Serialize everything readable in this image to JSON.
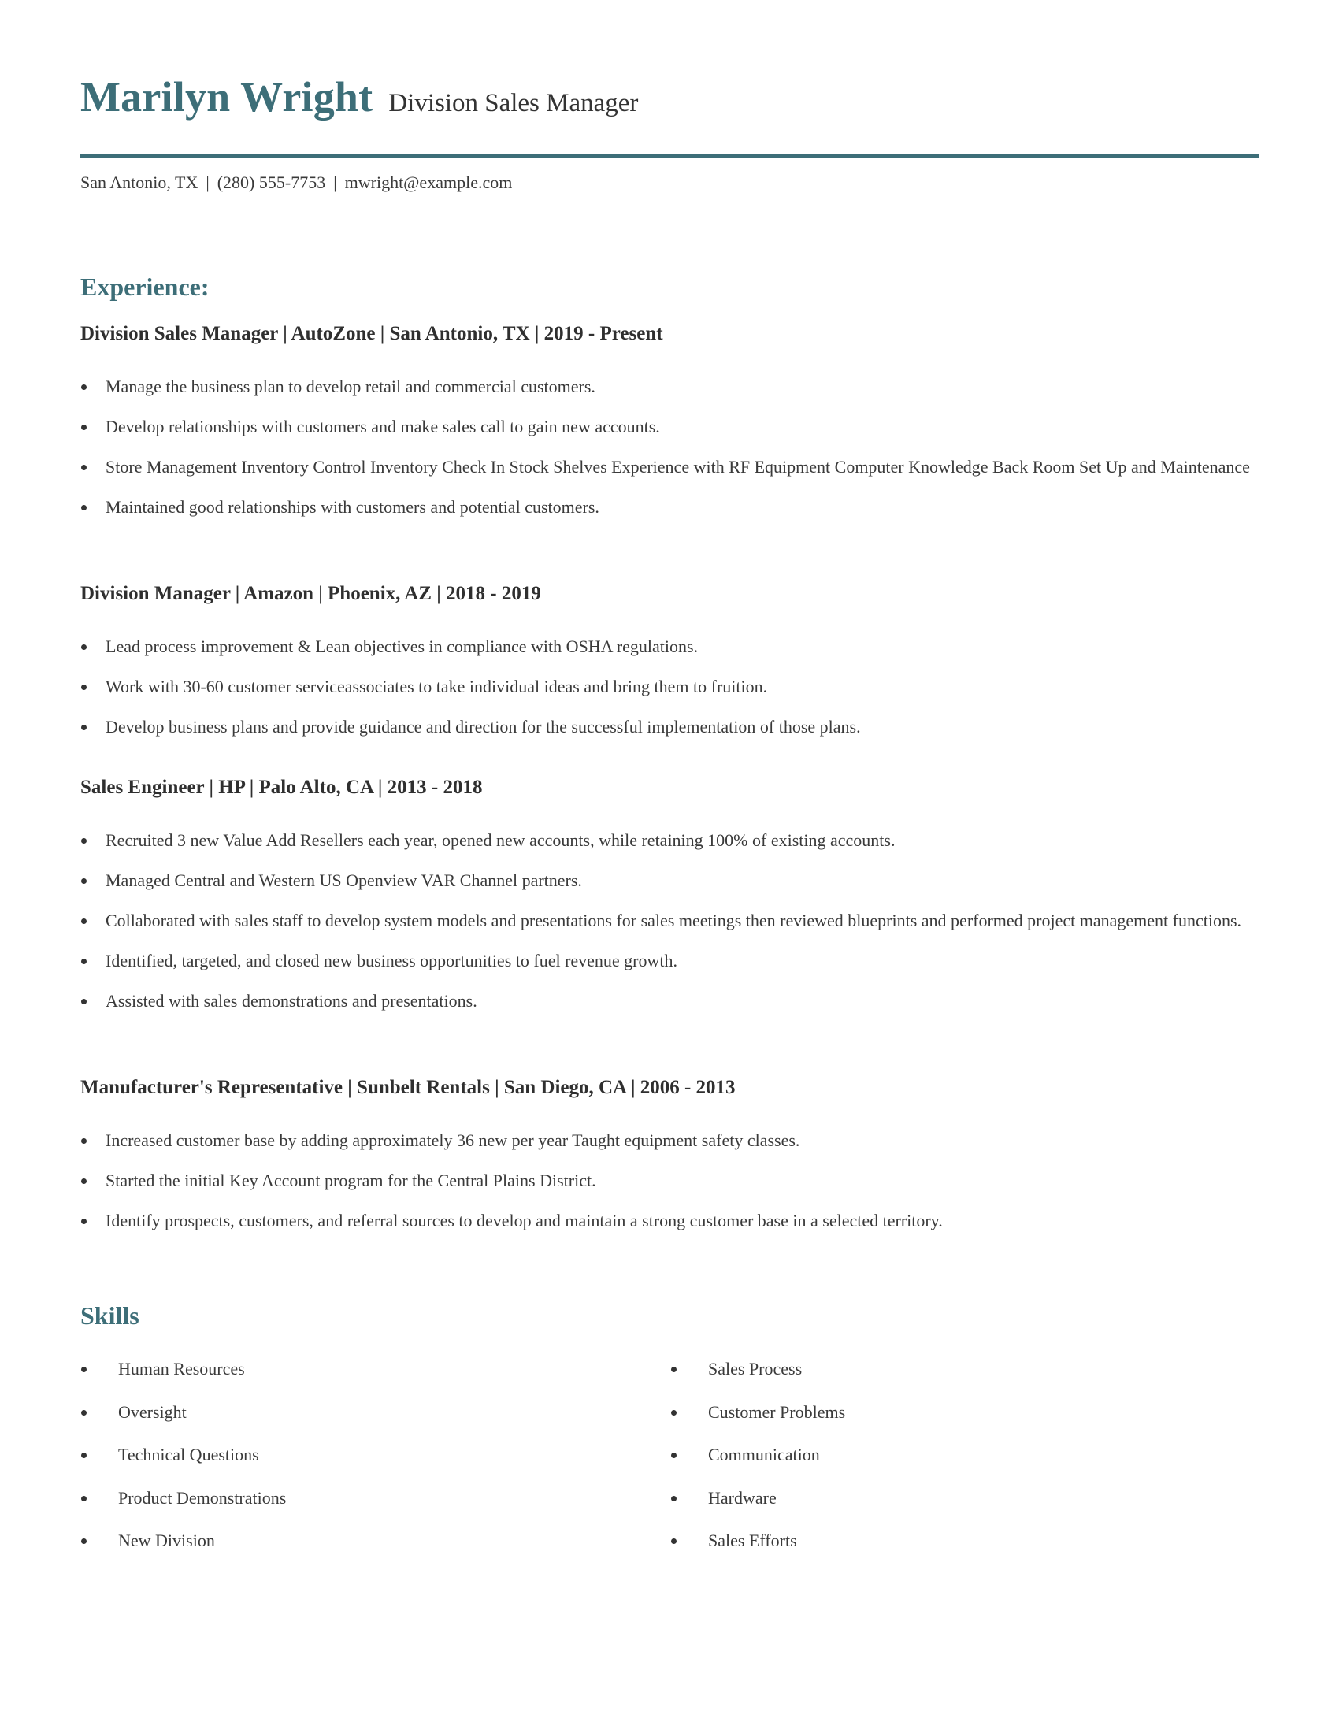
{
  "header": {
    "name": "Marilyn Wright",
    "title": "Division Sales Manager",
    "accent_color": "#3d6e78"
  },
  "contact": {
    "location": "San Antonio, TX",
    "phone": "(280) 555-7753",
    "email": "mwright@example.com",
    "separator": "|"
  },
  "experience": {
    "heading": "Experience:",
    "jobs": [
      {
        "heading": "Division Sales Manager | AutoZone | San Antonio, TX |  2019 - Present",
        "bullets": [
          "Manage the business plan to develop retail and commercial customers.",
          "Develop relationships with customers and make sales call to gain new accounts.",
          "Store Management Inventory Control Inventory Check In Stock Shelves Experience with RF Equipment Computer Knowledge Back Room Set Up and Maintenance",
          "Maintained good relationships with customers and potential customers."
        ]
      },
      {
        "heading": "Division Manager | Amazon | Phoenix, AZ |  2018 - 2019",
        "bullets": [
          "Lead process improvement & Lean objectives in compliance with OSHA regulations.",
          "Work with 30-60 customer serviceassociates to take individual ideas and bring them to fruition.",
          "Develop business plans and provide guidance and direction for the successful implementation of those plans."
        ]
      },
      {
        "heading": "Sales Engineer | HP | Palo Alto, CA |  2013 - 2018",
        "bullets": [
          "Recruited 3 new Value Add Resellers each year, opened new accounts, while retaining 100% of existing accounts.",
          "Managed Central and Western US Openview VAR Channel partners.",
          "Collaborated with sales staff to develop system models and presentations for sales meetings then reviewed blueprints and performed project management functions.",
          "Identified, targeted, and closed new business opportunities to fuel revenue growth.",
          "Assisted with sales demonstrations and presentations."
        ]
      },
      {
        "heading": "Manufacturer's Representative | Sunbelt Rentals | San Diego, CA |  2006 - 2013",
        "bullets": [
          "Increased customer base by adding approximately 36 new per year Taught equipment safety classes.",
          "Started the initial Key Account program for the Central Plains District.",
          "Identify prospects, customers, and referral sources to develop and maintain a strong customer base in a selected territory."
        ]
      }
    ]
  },
  "skills": {
    "heading": "Skills",
    "left": [
      "Human Resources",
      "Oversight",
      "Technical Questions",
      "Product Demonstrations",
      "New Division"
    ],
    "right": [
      "Sales Process",
      "Customer Problems",
      "Communication",
      "Hardware",
      "Sales Efforts"
    ]
  }
}
